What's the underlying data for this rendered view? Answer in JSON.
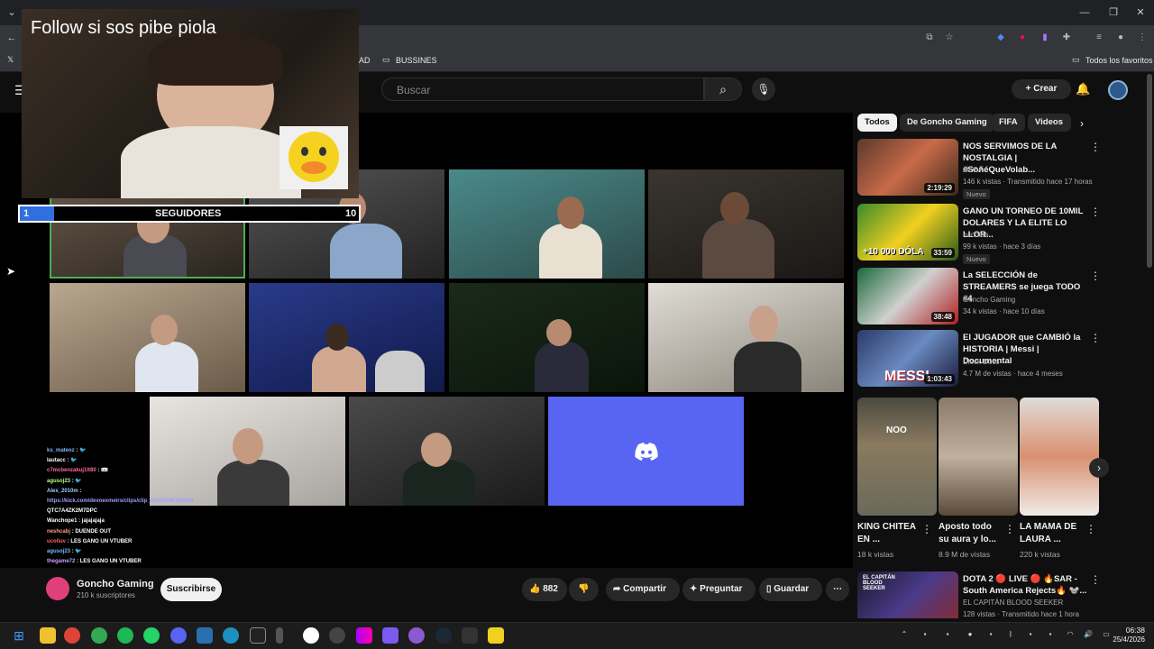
{
  "browser": {
    "bookmark_partial": "AD",
    "bookmark_folder": "BUSSINES",
    "bookmarks_all": "Todos los favoritos"
  },
  "youtube": {
    "search_placeholder": "Buscar",
    "create_label": "Crear"
  },
  "stream_overlay": {
    "follow_text": "Follow si sos pibe piola",
    "goal_label": "SEGUIDORES",
    "goal_current": "1",
    "goal_target": "10",
    "goal_progress": 0.1,
    "chat": [
      {
        "user": "ks_mateoz",
        "msg": ": 🐦"
      },
      {
        "user": "lautacc",
        "msg": ": 🐦"
      },
      {
        "user": "c7mcbenzakuj1lt80",
        "msg": ": 🎟"
      },
      {
        "user": "agusoj23",
        "msg": ": 🐦"
      },
      {
        "user": "Alex_2010m",
        "msg": ":"
      },
      {
        "user": "https://kick.com/devoexmeirs/clips/clip_01KPW4F1UGK8",
        "msg": "QTC7A4ZK2M7DPC"
      },
      {
        "user": "Wanchope1",
        "msg": ": jajajajaja"
      },
      {
        "user": "neshcabj",
        "msg": ": DUENDE OUT"
      },
      {
        "user": "ucolluv",
        "msg": ": LES GANO UN VTUBER"
      },
      {
        "user": "agusoj23",
        "msg": ": 🐦"
      },
      {
        "user": "thegame72",
        "msg": ": LES GANO UN VTUBER"
      }
    ]
  },
  "channel": {
    "name": "Goncho Gaming",
    "subscribers": "210 k suscriptores",
    "subscribe_label": "Suscribirse",
    "likes": "882",
    "share_label": "Compartir",
    "ask_label": "Preguntar",
    "save_label": "Guardar"
  },
  "sidebar": {
    "chips": [
      "Todos",
      "De Goncho Gaming",
      "FIFA",
      "Videos r"
    ],
    "recommendations": [
      {
        "title": "NOS SERVIMOS DE LA NOSTALGIA | #SoñéQueVolab...",
        "channel": "OLGA",
        "meta": "146 k vistas · Transmitido hace 17 horas",
        "badge": "Nuevo",
        "duration": "2:19:29"
      },
      {
        "title": "GANO UN TORNEO DE 10MIL DOLARES Y LA ELITE LO LLOR...",
        "channel": "nanoide",
        "meta": "99 k vistas · hace 3 días",
        "badge": "Nuevo",
        "duration": "33:59",
        "thumb_text": "+10 000 DÓLA"
      },
      {
        "title": "La SELECCIÓN de STREAMERS se juega TODO #4",
        "channel": "Goncho Gaming",
        "meta": "34 k vistas · hace 10 días",
        "duration": "38:48"
      },
      {
        "title": "El JUGADOR que CAMBIÓ la HISTORIA | Messi | Documental",
        "channel": "Dleck Docs",
        "meta": "4.7 M de vistas · hace 4 meses",
        "duration": "1:03:43",
        "thumb_text": "MESSI"
      }
    ],
    "shorts": [
      {
        "title": "KING CHITEA EN ...",
        "views": "18 k vistas",
        "thumb_text": "NOO"
      },
      {
        "title": "Aposto todo su aura y lo...",
        "views": "8.9 M de vistas"
      },
      {
        "title": "LA MAMA DE LAURA ...",
        "views": "220 k vistas"
      }
    ],
    "last_rec": {
      "title": "DOTA 2 🔴 LIVE 🔴 🔥SAR - South America Rejects🔥 🐭...",
      "channel": "EL CAPITÁN BLOOD SEEKER",
      "meta": "128 vistas · Transmitido hace 1 hora",
      "thumb_text": "EL CAPITÁN BLOOD SEEKER"
    }
  },
  "taskbar": {
    "time": "06:38",
    "date": "25/4/2026"
  }
}
